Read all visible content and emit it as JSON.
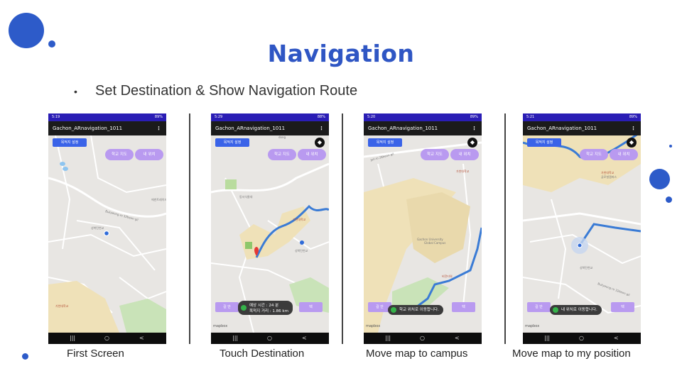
{
  "slide": {
    "title": "Navigation",
    "bullet": "Set Destination & Show Navigation Route",
    "bullet_symbol": "•"
  },
  "phones": [
    {
      "caption": "First Screen",
      "status_time": "5:19",
      "status_right": "89%",
      "app_title": "Gachon_ARnavigation_1011",
      "menu": "⋮",
      "dest_button": "목적지 설정",
      "school_map_button": "학교 지도",
      "my_location_button": "내 위치",
      "map_labels": [
        "Bukyeong-ro 32beon-gil",
        "성북탄천교",
        "에덴트레이드",
        "가천대학교"
      ]
    },
    {
      "caption": "Touch Destination",
      "status_time": "5:29",
      "status_right": "88%",
      "app_title": "Gachon_ARnavigation_1011",
      "menu": "⋮",
      "dest_button": "목적지 설정",
      "school_map_button": "학교 지도",
      "my_location_button": "내 위치",
      "compass": "◆",
      "toast_line1": "예상 시간 : 24 분",
      "toast_line2": "목적지 거리 : 1.86 km",
      "bottom_left": "길 안",
      "bottom_right": "택",
      "mapbox": "mapbox",
      "map_labels": [
        "dong",
        "성북탄천교",
        "가천대학교 글로벌캠퍼스"
      ]
    },
    {
      "caption": "Move map to campus",
      "status_time": "5:20",
      "status_right": "89%",
      "app_title": "Gachon_ARnavigation_1011",
      "menu": "⋮",
      "dest_button": "목적지 설정",
      "school_map_button": "학교 지도",
      "my_location_button": "내 위치",
      "compass": "◆",
      "toast": "학교 위치로 이동합니다.",
      "bottom_left": "길 안",
      "bottom_right": "택",
      "mapbox": "mapbox",
      "map_labels": [
        "Gachon University Global Campus",
        "가천대학교"
      ]
    },
    {
      "caption": "Move map to my position",
      "status_time": "5:21",
      "status_right": "89%",
      "app_title": "Gachon_ARnavigation_1011",
      "menu": "⋮",
      "dest_button": "목적지 설정",
      "school_map_button": "학교 지도",
      "my_location_button": "내 위치",
      "compass": "◆",
      "toast": "내 위치로 이동합니다.",
      "bottom_left": "길 안",
      "bottom_right": "택",
      "mapbox": "mapbox",
      "map_labels": [
        "가천대학교 글로벌캠퍼스",
        "성북탄천교",
        "Bukyeong-ro 32beon-gil"
      ]
    }
  ],
  "android_nav": {
    "recents": "|||",
    "home": "○",
    "back": "<"
  },
  "colors": {
    "accent": "#2f56c4",
    "route": "#3a7bd5",
    "status_bar": "#2a1db5",
    "pill": "#b99af0",
    "dest_button": "#3a63e8"
  }
}
